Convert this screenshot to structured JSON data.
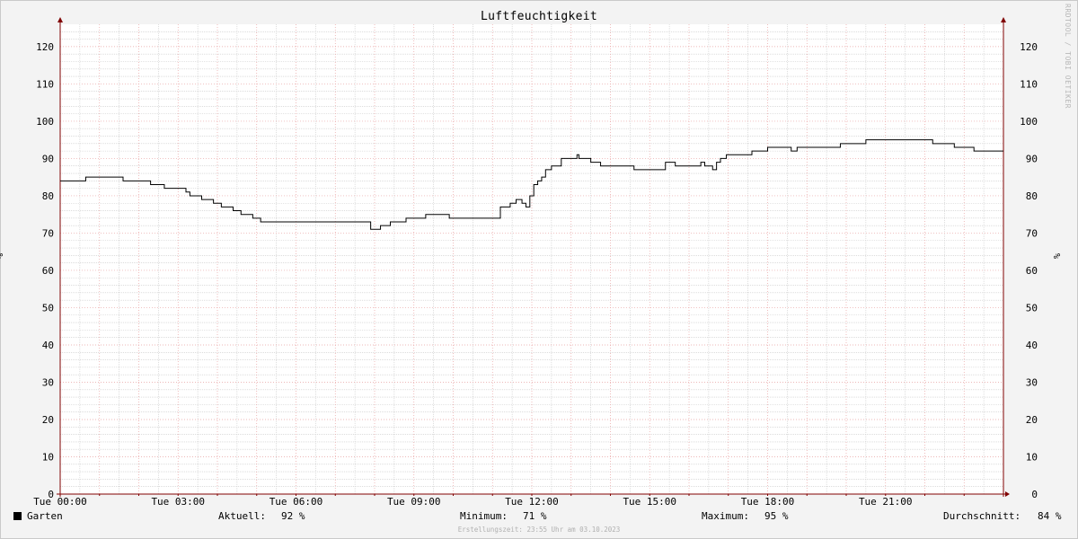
{
  "watermark": "RRDTOOL / TOBI OETIKER",
  "footer": "Erstellungszeit: 23:55 Uhr am 03.10.2023",
  "stats": {
    "current_label": "Aktuell:",
    "current_value": "92 %",
    "min_label": "Minimum:",
    "min_value": "71 %",
    "max_label": "Maximum:",
    "max_value": "95 %",
    "avg_label": "Durchschnitt:",
    "avg_value": "84 %"
  },
  "colors": {
    "background": "#f3f3f3",
    "canvas": "#ffffff",
    "minor_grid": "#c8c8c8",
    "major_grid": "#e8a0a0",
    "axis": "#800000",
    "series": "#000000"
  },
  "chart_data": {
    "type": "line",
    "title": "Luftfeuchtigkeit",
    "ylabel": "%",
    "ylim": [
      0,
      126
    ],
    "xlim": [
      0,
      24
    ],
    "grid": true,
    "legend": "bottom-left",
    "x_tick_labels": [
      {
        "x": 0,
        "label": "Tue 00:00"
      },
      {
        "x": 3,
        "label": "Tue 03:00"
      },
      {
        "x": 6,
        "label": "Tue 06:00"
      },
      {
        "x": 9,
        "label": "Tue 09:00"
      },
      {
        "x": 12,
        "label": "Tue 12:00"
      },
      {
        "x": 15,
        "label": "Tue 15:00"
      },
      {
        "x": 18,
        "label": "Tue 18:00"
      },
      {
        "x": 21,
        "label": "Tue 21:00"
      }
    ],
    "y_ticks": [
      0,
      10,
      20,
      30,
      40,
      50,
      60,
      70,
      80,
      90,
      100,
      110,
      120
    ],
    "series": [
      {
        "name": "Garten",
        "step": true,
        "points": [
          [
            0.0,
            84
          ],
          [
            0.65,
            85
          ],
          [
            1.6,
            84
          ],
          [
            2.3,
            83
          ],
          [
            2.65,
            82
          ],
          [
            3.2,
            81
          ],
          [
            3.3,
            80
          ],
          [
            3.6,
            79
          ],
          [
            3.9,
            78
          ],
          [
            4.1,
            77
          ],
          [
            4.4,
            76
          ],
          [
            4.6,
            75
          ],
          [
            4.9,
            74
          ],
          [
            5.1,
            73
          ],
          [
            7.9,
            71
          ],
          [
            8.15,
            72
          ],
          [
            8.4,
            73
          ],
          [
            8.8,
            74
          ],
          [
            9.3,
            75
          ],
          [
            9.9,
            74
          ],
          [
            11.2,
            77
          ],
          [
            11.45,
            78
          ],
          [
            11.6,
            79
          ],
          [
            11.75,
            78
          ],
          [
            11.85,
            77
          ],
          [
            11.95,
            80
          ],
          [
            12.05,
            83
          ],
          [
            12.15,
            84
          ],
          [
            12.25,
            85
          ],
          [
            12.35,
            87
          ],
          [
            12.5,
            88
          ],
          [
            12.75,
            90
          ],
          [
            13.15,
            91
          ],
          [
            13.2,
            90
          ],
          [
            13.5,
            89
          ],
          [
            13.75,
            88
          ],
          [
            14.6,
            87
          ],
          [
            15.4,
            89
          ],
          [
            15.65,
            88
          ],
          [
            16.3,
            89
          ],
          [
            16.4,
            88
          ],
          [
            16.6,
            87
          ],
          [
            16.7,
            89
          ],
          [
            16.8,
            90
          ],
          [
            16.95,
            91
          ],
          [
            17.6,
            92
          ],
          [
            18.0,
            93
          ],
          [
            18.6,
            92
          ],
          [
            18.75,
            93
          ],
          [
            19.85,
            94
          ],
          [
            20.5,
            95
          ],
          [
            22.2,
            94
          ],
          [
            22.75,
            93
          ],
          [
            23.25,
            92
          ],
          [
            24.0,
            92
          ]
        ]
      }
    ]
  }
}
